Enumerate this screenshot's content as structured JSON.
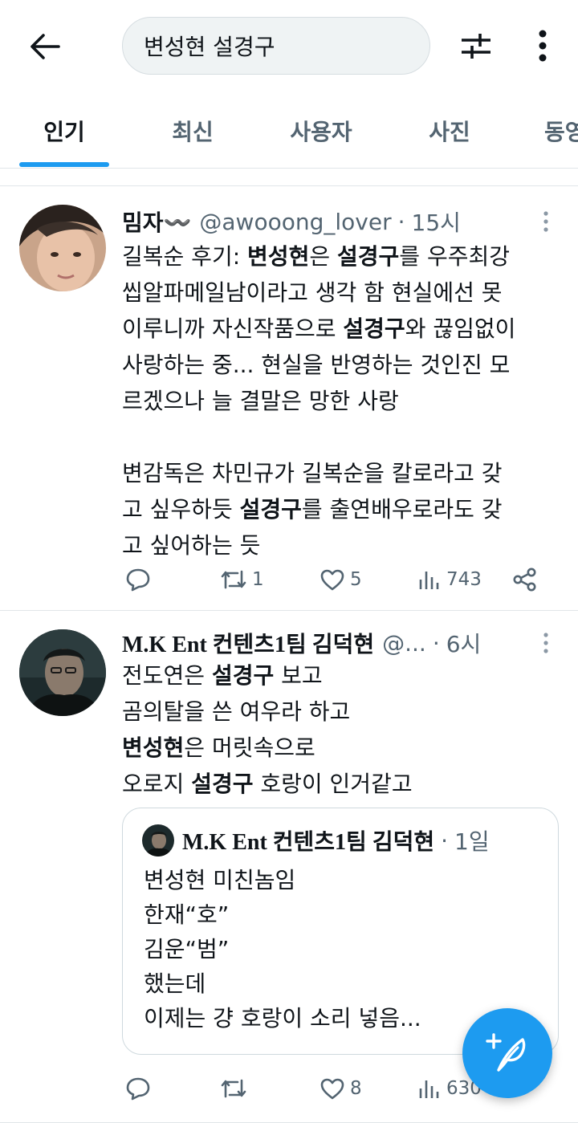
{
  "header": {
    "back_icon": "arrow-left-icon",
    "search_query": "변성현 설경구",
    "filter_icon": "sliders-icon",
    "more_icon": "more-vertical-icon"
  },
  "tabs": [
    {
      "label": "인기",
      "active": true
    },
    {
      "label": "최신",
      "active": false
    },
    {
      "label": "사용자",
      "active": false
    },
    {
      "label": "사진",
      "active": false
    },
    {
      "label": "동영",
      "active": false
    }
  ],
  "tweets": [
    {
      "name": "밈자〰️",
      "handle": "@awooong_lover",
      "time": "15시",
      "body_lines": [
        "길복순 후기: 변성현은 설경구를 우주최강",
        "씹알파메일남이라고 생각 함 현실에선 못",
        "이루니까 자신작품으로 설경구와 끊임없이",
        "사랑하는 중... 현실을 반영하는 것인진 모",
        "르겠으나 늘 결말은 망한 사랑",
        "",
        "변감독은 차민규가 길복순을 칼로라고 갖",
        "고 싶우하듯 설경구를 출연배우로라도 갖",
        "고 싶어하는 듯"
      ],
      "reply_count": "",
      "retweet_count": "1",
      "like_count": "5",
      "view_count": "743"
    },
    {
      "name": "M.K Ent 컨텐츠1팀 김덕현",
      "handle": "@...",
      "time": "6시",
      "body_lines": [
        "전도연은 설경구 보고",
        "곰의탈을 쓴 여우라 하고",
        "변성현은 머릿속으로",
        "오로지 설경구 호랑이 인거같고"
      ],
      "quote": {
        "name": "M.K Ent 컨텐츠1팀 김덕현",
        "time": "1일",
        "body_lines": [
          "변성현 미친놈임",
          "한재“호”",
          "김운“범”",
          "했는데",
          "이제는 걍 호랑이 소리 넣음..."
        ]
      },
      "reply_count": "",
      "retweet_count": "",
      "like_count": "8",
      "view_count": "630"
    }
  ],
  "fab": {
    "icon": "compose-feather-icon"
  },
  "colors": {
    "accent": "#1d9bf0",
    "text": "#0f1419",
    "muted": "#536471",
    "border": "#e1e6e9"
  }
}
